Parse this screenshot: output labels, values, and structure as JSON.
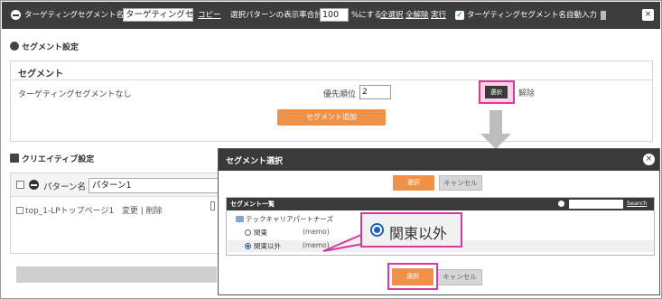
{
  "topbar": {
    "segment_name_label": "ターゲティングセグメント名",
    "segment_name_value": "ターゲティングセグ",
    "copy_link": "コピー",
    "pattern_total_label": "選択パターンの表示率合計を",
    "pattern_total_value": "100",
    "pattern_total_suffix": "%にする",
    "select_all": "全選択",
    "deselect_all": "全解除",
    "execute": "実行",
    "auto_input_checked": true,
    "auto_input_label": "ターゲティングセグメント名自動入力",
    "close_icon": "×"
  },
  "segment_settings": {
    "header": "セグメント設定",
    "box_title": "セグメント",
    "no_targeting": "ターゲティングセグメントなし",
    "priority_label": "優先順位",
    "priority_value": "2",
    "select_button": "選択",
    "cancel_link": "解除",
    "add_segment_button": "セグメント追加"
  },
  "creative_settings": {
    "header": "クリエイティブ設定",
    "pattern_label": "パターン名",
    "pattern_value": "パターン1",
    "item_text": "top_1-LPトップページ1",
    "change_link": "変更",
    "delete_link": "削除"
  },
  "modal": {
    "title": "セグメント選択",
    "top_select_button": "選択",
    "top_cancel_button": "キャンセル",
    "list_header": "セグメント一覧",
    "search_link": "Search",
    "folder_name": "テックキャリアパートナーズ",
    "options": [
      {
        "label": "関東",
        "memo": "(memo)",
        "selected": false
      },
      {
        "label": "関東以外",
        "memo": "(memo)",
        "selected": true
      }
    ],
    "bottom_select_button": "選択",
    "bottom_cancel_button": "キャンセル",
    "close_icon": "×"
  },
  "callout": {
    "label": "関東以外"
  },
  "colors": {
    "dark_bar": "#3d3d3d",
    "accent_orange": "#f0914a",
    "highlight_pink": "#d83a9c",
    "radio_blue": "#1a5fc0"
  }
}
